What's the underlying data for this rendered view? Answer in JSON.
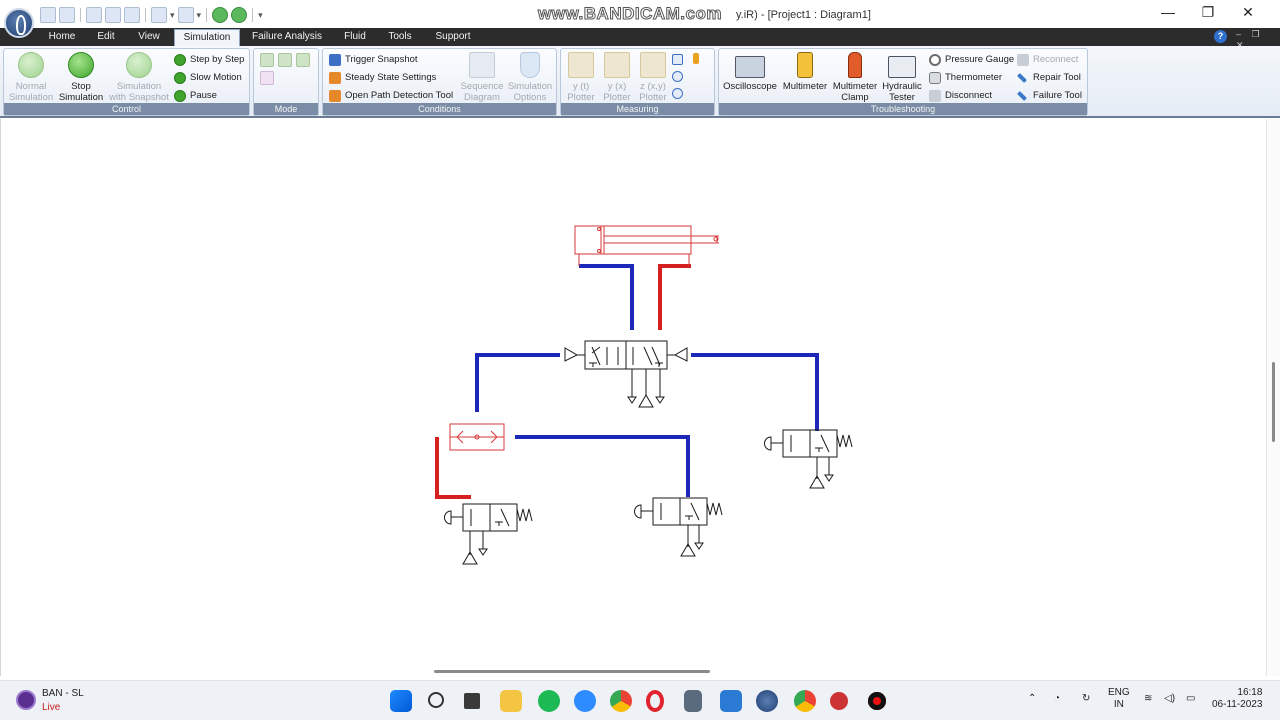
{
  "window": {
    "watermark": "www.BANDICAM.com",
    "title_suffix": "y.iR) - [Project1 : Diagram1]",
    "controls": {
      "minimize": "—",
      "maximize": "❐",
      "close": "✕"
    }
  },
  "tabs": [
    {
      "label": "Home"
    },
    {
      "label": "Edit"
    },
    {
      "label": "View"
    },
    {
      "label": "Simulation",
      "active": true
    },
    {
      "label": "Failure Analysis"
    },
    {
      "label": "Fluid"
    },
    {
      "label": "Tools"
    },
    {
      "label": "Support"
    }
  ],
  "ribbon": {
    "control": {
      "label": "Control",
      "normal_simulation": "Normal Simulation",
      "stop_simulation": "Stop Simulation",
      "simulation_with_snapshot": "Simulation with Snapshot",
      "step_by_step": "Step by Step",
      "slow_motion": "Slow Motion",
      "pause": "Pause"
    },
    "mode": {
      "label": "Mode"
    },
    "conditions": {
      "label": "Conditions",
      "trigger_snapshot": "Trigger Snapshot",
      "steady_state_settings": "Steady State Settings",
      "open_path_detection_tool": "Open Path Detection Tool",
      "sequence_diagram": "Sequence Diagram",
      "simulation_options": "Simulation Options"
    },
    "measuring": {
      "label": "Measuring",
      "yt_plotter": "y (t) Plotter",
      "yx_plotter": "y (x) Plotter",
      "zxy_plotter": "z (x,y) Plotter"
    },
    "troubleshooting": {
      "label": "Troubleshooting",
      "oscilloscope": "Oscilloscope",
      "multimeter": "Multimeter",
      "multimeter_clamp": "Multimeter Clamp",
      "hydraulic_tester": "Hydraulic Tester",
      "pressure_gauge": "Pressure Gauge",
      "thermometer": "Thermometer",
      "disconnect": "Disconnect",
      "reconnect": "Reconnect",
      "repair_tool": "Repair Tool",
      "failure_tool": "Failure Tool"
    }
  },
  "colors": {
    "pressurized_line": "#d61f1f",
    "exhaust_line": "#1d28b8",
    "active_component": "#d63a3a",
    "component": "#1a1a1a"
  },
  "taskbar": {
    "live_title": "BAN - SL",
    "live_status": "Live",
    "language_top": "ENG",
    "language_bottom": "IN",
    "time": "16:18",
    "date": "06-11-2023"
  }
}
